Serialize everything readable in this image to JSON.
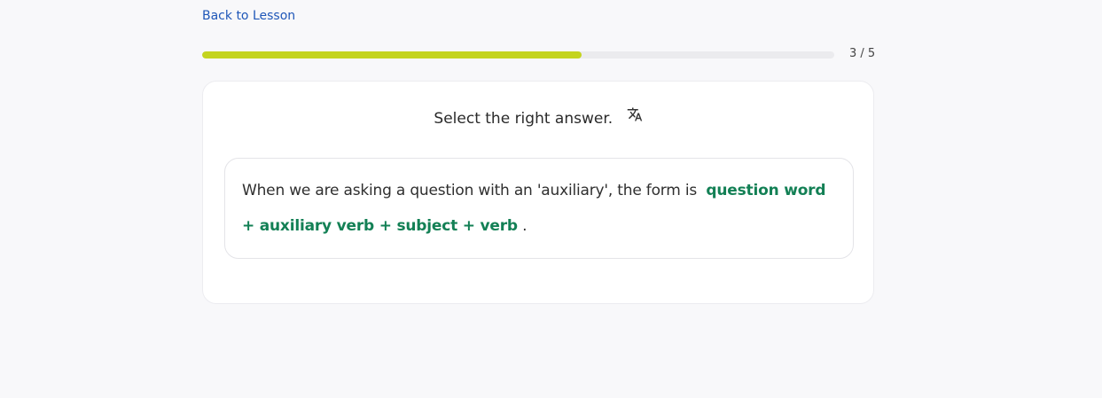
{
  "nav": {
    "back_label": "Back to Lesson"
  },
  "progress": {
    "current": 3,
    "total": 5,
    "fraction": 0.6,
    "label": "3 / 5",
    "fill_color": "#c4d41e"
  },
  "card": {
    "instruction": "Select the right answer.",
    "translate_icon": "translate-icon",
    "content": {
      "text_before": "When we are asking a question with an 'auxiliary', the form is",
      "highlight": "question word + auxiliary verb + subject + verb",
      "text_after": "."
    }
  },
  "colors": {
    "background": "#f8f8fa",
    "link": "#1f57b8",
    "highlight": "#138055"
  }
}
